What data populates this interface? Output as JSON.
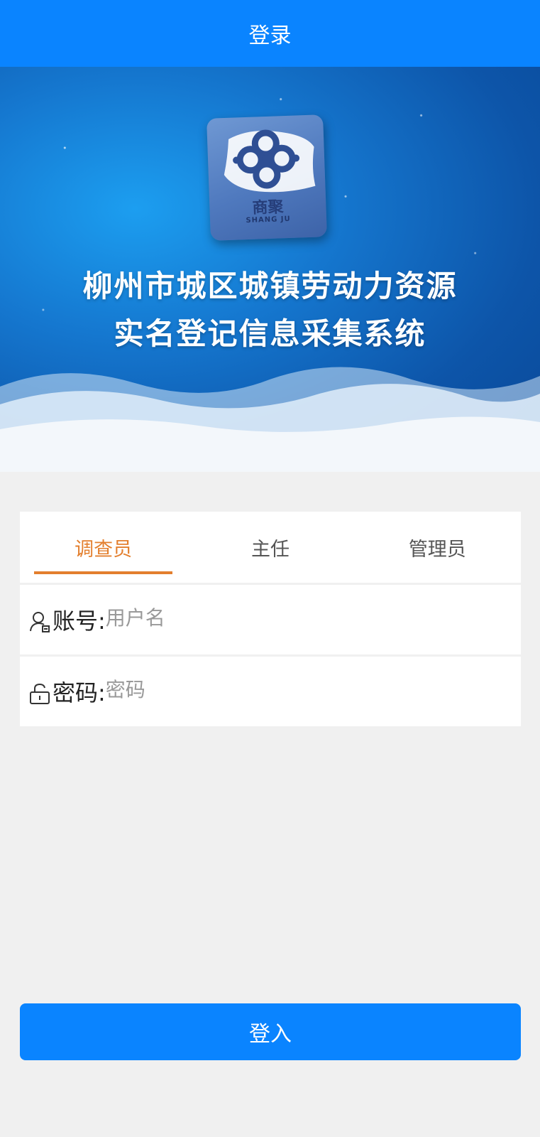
{
  "header": {
    "title": "登录"
  },
  "banner": {
    "logo_cn": "商聚",
    "logo_en": "SHANG JU",
    "title_line1": "柳州市城区城镇劳动力资源",
    "title_line2": "实名登记信息采集系统"
  },
  "tabs": [
    {
      "label": "调查员",
      "active": true
    },
    {
      "label": "主任",
      "active": false
    },
    {
      "label": "管理员",
      "active": false
    }
  ],
  "form": {
    "account": {
      "label": "账号:",
      "value": "",
      "placeholder": "用户名",
      "icon": "user-icon"
    },
    "password": {
      "label": "密码:",
      "value": "",
      "placeholder": "密码",
      "icon": "lock-icon"
    }
  },
  "login_button": {
    "label": "登入"
  },
  "colors": {
    "primary": "#0a84ff",
    "active_tab": "#e37f2e",
    "background": "#f0f0f0"
  }
}
